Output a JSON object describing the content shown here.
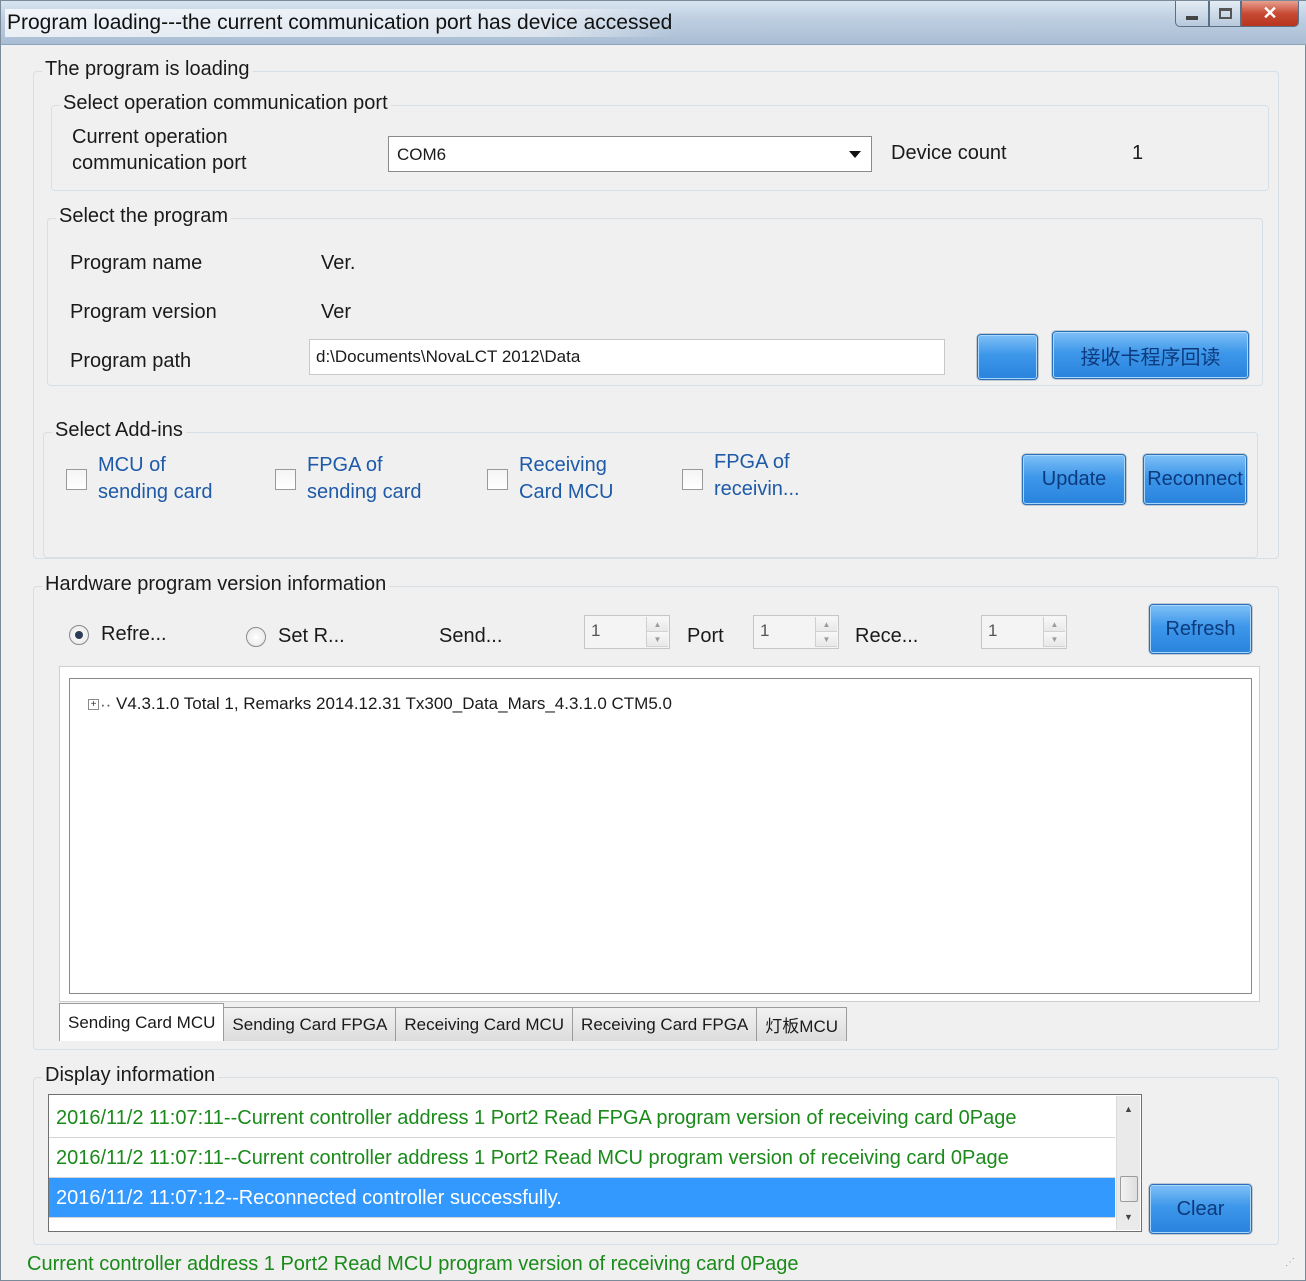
{
  "window": {
    "title": "Program loading---the current communication port has device accessed"
  },
  "loading": {
    "legend": "The program is loading",
    "port_group": {
      "legend": "Select operation communication port",
      "port_label_line1": "Current operation",
      "port_label_line2": "communication port",
      "port_value": "COM6",
      "device_count_label": "Device count",
      "device_count_value": "1"
    },
    "program_group": {
      "legend": "Select the program",
      "name_label": "Program name",
      "name_value": "Ver.",
      "version_label": "Program version",
      "version_value": "Ver",
      "path_label": "Program path",
      "path_value": "d:\\Documents\\NovaLCT 2012\\Data",
      "browse_label": "",
      "readback_label": "接收卡程序回读"
    },
    "addins_group": {
      "legend": "Select Add-ins",
      "items": [
        {
          "line1": "MCU of",
          "line2": "sending card",
          "checked": false
        },
        {
          "line1": "FPGA of",
          "line2": "sending card",
          "checked": false
        },
        {
          "line1": "Receiving",
          "line2": "Card MCU",
          "checked": false
        },
        {
          "line1": "FPGA of",
          "line2": "receivin...",
          "checked": false
        }
      ],
      "update_label": "Update",
      "reconnect_label": "Reconnect"
    }
  },
  "hardware": {
    "legend": "Hardware program version information",
    "radio_refresh": "Refre...",
    "radio_set": "Set R...",
    "send_label": "Send...",
    "send_value": "1",
    "port_label": "Port",
    "port_value": "1",
    "rece_label": "Rece...",
    "rece_value": "1",
    "refresh_label": "Refresh",
    "tree_item": "V4.3.1.0 Total 1, Remarks 2014.12.31 Tx300_Data_Mars_4.3.1.0 CTM5.0",
    "tabs": [
      "Sending Card MCU",
      "Sending Card FPGA",
      "Receiving Card MCU",
      "Receiving Card FPGA",
      "灯板MCU"
    ],
    "active_tab": 0
  },
  "display": {
    "legend": "Display information",
    "log": [
      "2016/11/2 11:07:11--Current controller address 1 Port2 Read FPGA program version of receiving card 0Page",
      "2016/11/2 11:07:11--Current controller address 1 Port2 Read MCU program version of receiving card 0Page",
      "2016/11/2 11:07:12--Reconnected controller successfully."
    ],
    "selected_row": 2,
    "clear_label": "Clear"
  },
  "status": {
    "text": "Current controller address 1 Port2 Read MCU program version of receiving card 0Page"
  },
  "colors": {
    "log_text": "#1a8a1a",
    "selection": "#3399ff",
    "button_blue": "#3d97ea",
    "label_blue": "#1e5aa8"
  }
}
